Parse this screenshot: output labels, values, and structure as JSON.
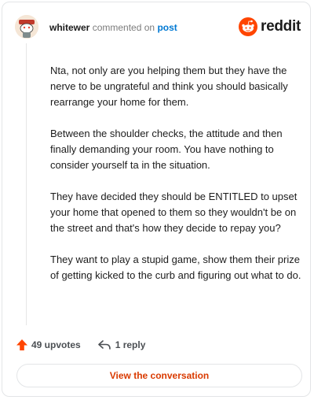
{
  "header": {
    "username": "whitewer",
    "action": "commented on",
    "post_link": "post",
    "brand": "reddit"
  },
  "comment": {
    "paragraphs": [
      "Nta, not only are you helping them but they have the nerve to be ungrateful and think you should basically rearrange your home for them.",
      "Between the shoulder checks, the attitude and then finally demanding your room. You have nothing to consider yourself ta in the situation.",
      "They have decided they should be ENTITLED to upset your home that opened to them so they wouldn't be on the street and that's how they decide to repay you?",
      "They want to play a stupid game, show them their prize of getting kicked to the curb and figuring out what to do."
    ]
  },
  "footer": {
    "upvotes": "49 upvotes",
    "replies": "1 reply"
  },
  "cta": {
    "label": "View the conversation"
  },
  "colors": {
    "brand_orange": "#ff4500",
    "link_blue": "#0079d3",
    "cta_text": "#d93a00"
  }
}
